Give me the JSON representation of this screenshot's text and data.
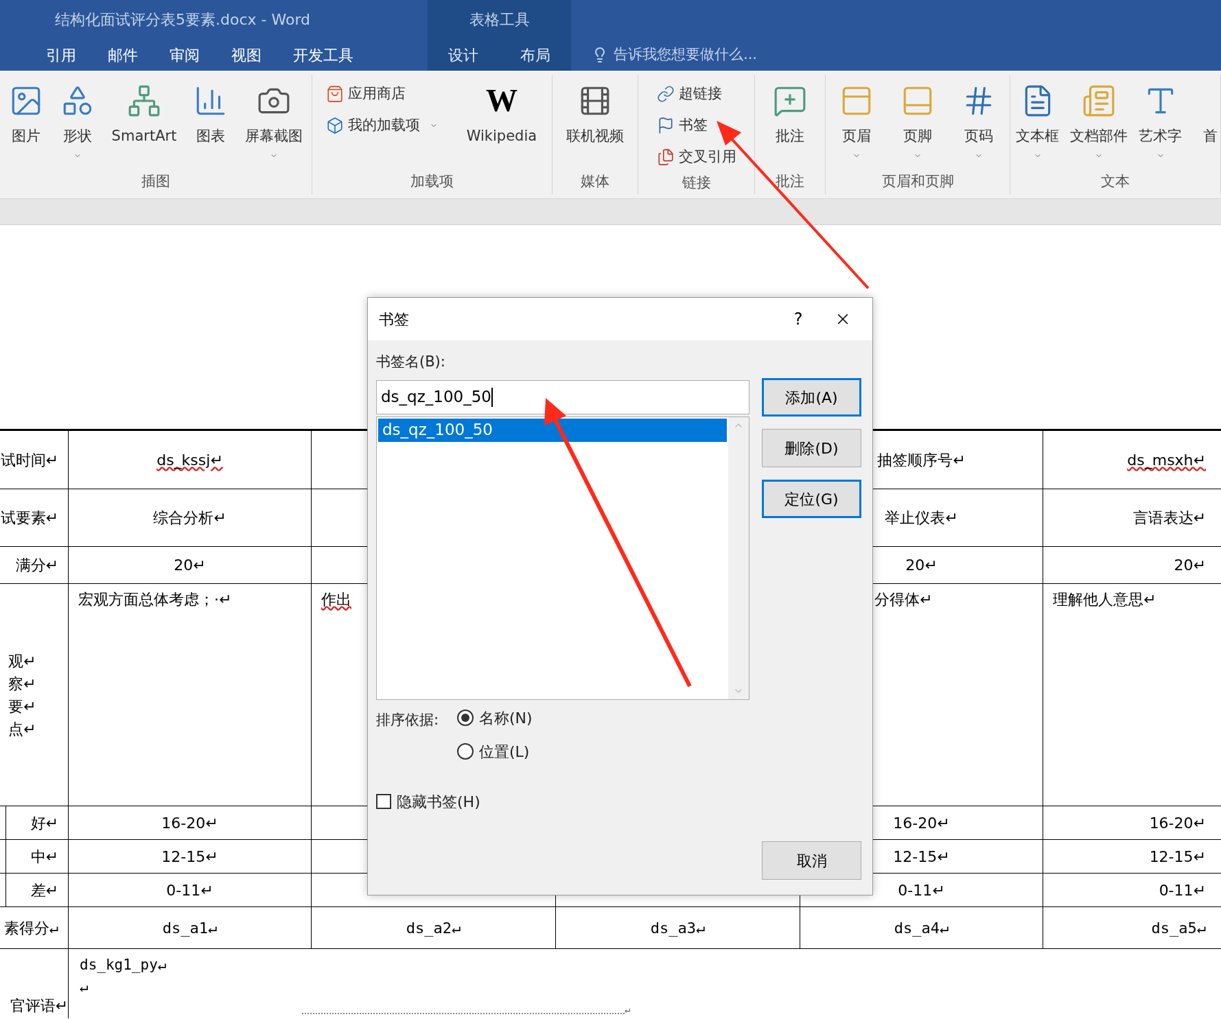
{
  "window": {
    "title": "结构化面试评分表5要素.docx - Word",
    "context_label": "表格工具"
  },
  "tabs": [
    {
      "label": "引用",
      "contextual": false
    },
    {
      "label": "邮件",
      "contextual": false
    },
    {
      "label": "审阅",
      "contextual": false
    },
    {
      "label": "视图",
      "contextual": false
    },
    {
      "label": "开发工具",
      "contextual": false
    },
    {
      "label": "设计",
      "contextual": true
    },
    {
      "label": "布局",
      "contextual": true
    }
  ],
  "tell_me": {
    "placeholder": "告诉我您想要做什么..."
  },
  "ribbon_groups": [
    {
      "label": "插图",
      "items": [
        {
          "kind": "large",
          "label": "图片",
          "dropdown": false
        },
        {
          "kind": "large",
          "label": "形状",
          "dropdown": true
        },
        {
          "kind": "large",
          "label": "SmartArt",
          "dropdown": false
        },
        {
          "kind": "large",
          "label": "图表",
          "dropdown": false
        },
        {
          "kind": "large",
          "label": "屏幕截图",
          "dropdown": true
        }
      ]
    },
    {
      "label": "加载项",
      "items": [
        {
          "kind": "small",
          "label": "应用商店",
          "dropdown": false
        },
        {
          "kind": "small",
          "label": "我的加载项",
          "dropdown": true
        },
        {
          "kind": "large",
          "logo_text": "W",
          "label": "Wikipedia",
          "dropdown": false
        }
      ]
    },
    {
      "label": "媒体",
      "items": [
        {
          "kind": "large",
          "label": "联机视频",
          "dropdown": false
        }
      ]
    },
    {
      "label": "链接",
      "items": [
        {
          "kind": "small",
          "label": "超链接",
          "dropdown": false
        },
        {
          "kind": "small",
          "label": "书签",
          "dropdown": false
        },
        {
          "kind": "small",
          "label": "交叉引用",
          "dropdown": false
        }
      ]
    },
    {
      "label": "批注",
      "items": [
        {
          "kind": "large",
          "label": "批注",
          "dropdown": false
        }
      ]
    },
    {
      "label": "页眉和页脚",
      "items": [
        {
          "kind": "large",
          "label": "页眉",
          "dropdown": true
        },
        {
          "kind": "large",
          "label": "页脚",
          "dropdown": true
        },
        {
          "kind": "large",
          "label": "页码",
          "dropdown": true
        }
      ]
    },
    {
      "label": "文本",
      "items": [
        {
          "kind": "large",
          "label": "文本框",
          "dropdown": true
        },
        {
          "kind": "large",
          "label": "文档部件",
          "dropdown": true
        },
        {
          "kind": "large",
          "label": "艺术字",
          "dropdown": true
        },
        {
          "kind": "large",
          "label": "首",
          "dropdown": false
        }
      ]
    }
  ],
  "table": {
    "rows": [
      {
        "kind": "standard",
        "column_1": {
          "text": "试时间↵",
          "misspelled": false
        },
        "column_2": {
          "text": "ds_kssj↵",
          "misspelled": true
        },
        "column_5": {
          "text": "抽签顺序号↵",
          "misspelled": false
        },
        "column_6": {
          "text": "ds_msxh↵",
          "misspelled": true
        }
      },
      {
        "kind": "standard",
        "column_1": {
          "text": "试要素↵",
          "misspelled": false
        },
        "column_2": {
          "text": "综合分析↵",
          "misspelled": false
        },
        "column_5": {
          "text": "举止仪表↵",
          "misspelled": false
        },
        "column_6": {
          "text": "言语表达↵",
          "misspelled": false
        }
      },
      {
        "kind": "standard",
        "column_1": {
          "text": "满分↵",
          "misspelled": false
        },
        "column_2": {
          "text": "20↵",
          "misspelled": false
        },
        "column_5": {
          "text": "20↵",
          "misspelled": false
        },
        "column_6": {
          "text": "20↵",
          "misspelled": false
        }
      },
      {
        "kind": "notes",
        "column_1": {
          "lines": [
            "观↵",
            "察↵",
            "要↵",
            "点↵"
          ],
          "misspelled": false
        },
        "column_2": {
          "text": "宏观方面总体考虑；·↵",
          "misspelled": false
        },
        "column_3": {
          "text": "作出",
          "misspelled": true
        },
        "column_5": {
          "text": "分得体↵",
          "misspelled": false
        },
        "column_6": {
          "text": "理解他人意思↵",
          "misspelled": false
        }
      },
      {
        "kind": "rating",
        "column_1": {
          "text": "好↵",
          "misspelled": false
        },
        "column_2": {
          "text": "16-20↵",
          "misspelled": false
        },
        "column_5": {
          "text": "16-20↵",
          "misspelled": false
        },
        "column_6": {
          "text": "16-20↵",
          "misspelled": false
        }
      },
      {
        "kind": "rating",
        "column_1": {
          "text": "中↵",
          "misspelled": false
        },
        "column_2": {
          "text": "12-15↵",
          "misspelled": false
        },
        "column_5": {
          "text": "12-15↵",
          "misspelled": false
        },
        "column_6": {
          "text": "12-15↵",
          "misspelled": false
        }
      },
      {
        "kind": "rating",
        "column_1": {
          "text": "差↵",
          "misspelled": false
        },
        "column_2": {
          "text": "0-11↵",
          "misspelled": false
        },
        "column_5": {
          "text": "0-11↵",
          "misspelled": false
        },
        "column_6": {
          "text": "0-11↵",
          "misspelled": false
        }
      },
      {
        "kind": "standard",
        "column_1": {
          "text": "素得分↵",
          "misspelled": false
        },
        "column_2": {
          "text": "ds_a1↵",
          "misspelled": false
        },
        "column_3": {
          "text": "ds_a2↵",
          "misspelled": false
        },
        "column_4": {
          "text": "ds_a3↵",
          "misspelled": false
        },
        "column_5": {
          "text": "ds_a4↵",
          "misspelled": false
        },
        "column_6": {
          "text": "ds_a5↵",
          "misspelled": false
        }
      },
      {
        "kind": "comment",
        "column_1": {
          "text": "官评语↵",
          "misspelled": false
        },
        "column_2": {
          "lines": [
            "ds_kg1_py↵",
            "↵"
          ],
          "misspelled": false
        },
        "end_mark": "↵"
      }
    ]
  },
  "dialog": {
    "title": "书签",
    "help": "?",
    "name_label": "书签名(B):",
    "name_value": "ds_qz_100_50",
    "bookmarks": [
      {
        "label": "ds_qz_100_50",
        "selected": true
      }
    ],
    "buttons": [
      {
        "label": "添加(A)",
        "highlighted": true
      },
      {
        "label": "删除(D)",
        "highlighted": false
      },
      {
        "label": "定位(G)",
        "highlighted": true
      }
    ],
    "sort_label": "排序依据:",
    "sort_options": [
      {
        "label": "名称(N)",
        "selected": true
      },
      {
        "label": "位置(L)",
        "selected": false
      }
    ],
    "hide_option": {
      "label": "隐藏书签(H)",
      "checked": false
    },
    "cancel": "取消"
  }
}
